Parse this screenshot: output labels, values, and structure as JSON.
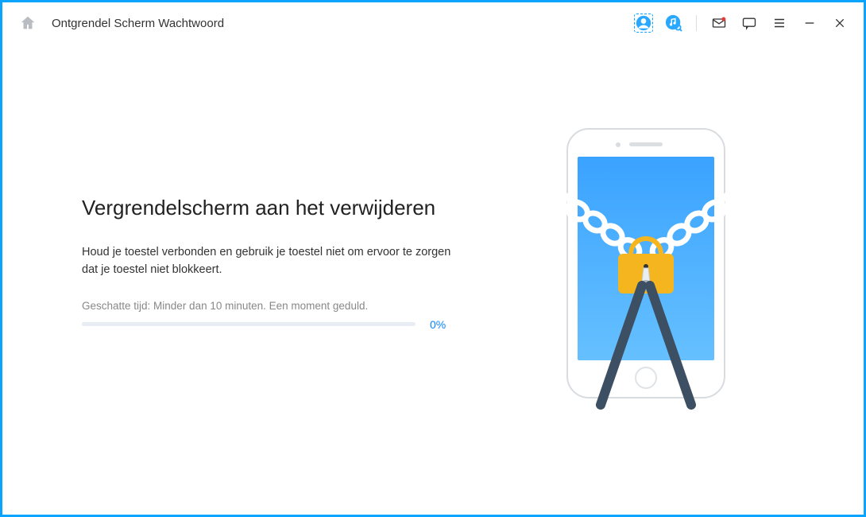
{
  "titlebar": {
    "title": "Ontgrendel Scherm Wachtwoord"
  },
  "main": {
    "heading": "Vergrendelscherm aan het verwijderen",
    "description": "Houd je toestel verbonden en gebruik je toestel niet om ervoor te zorgen dat je toestel niet blokkeert.",
    "eta": "Geschatte tijd: Minder dan 10 minuten. Een moment geduld.",
    "percent_label": "0%",
    "progress_percent": 0
  },
  "colors": {
    "accent": "#0aa4ff",
    "lock": "#f4b51e"
  }
}
